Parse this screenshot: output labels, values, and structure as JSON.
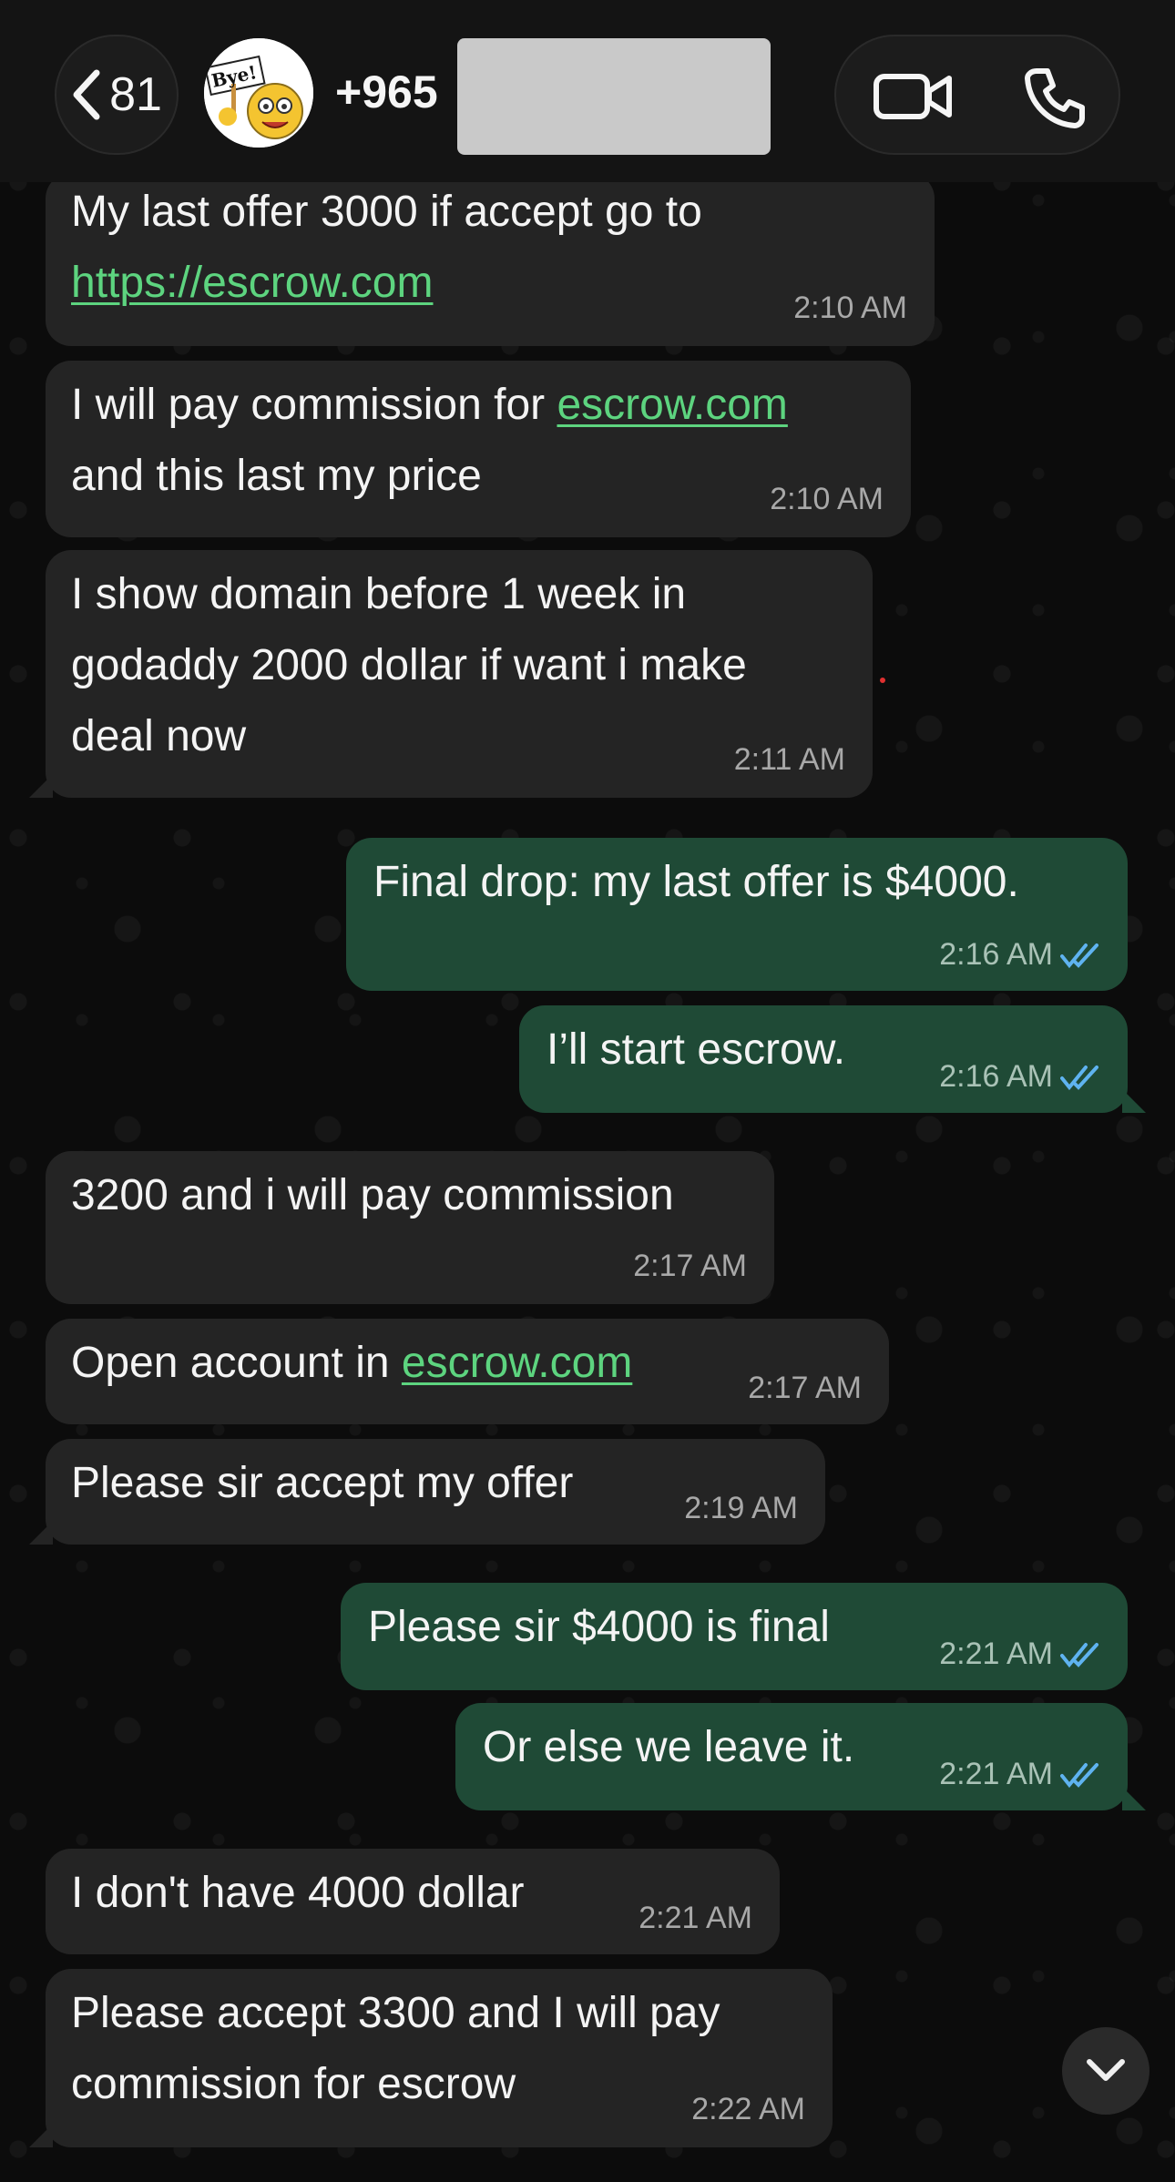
{
  "header": {
    "back_count": "81",
    "contact_label": "+965",
    "avatar_sign_text": "Bye!",
    "icons": [
      "chevron-left-icon",
      "video-call-icon",
      "phone-icon"
    ]
  },
  "colors": {
    "incoming_bubble": "#242424",
    "outgoing_bubble": "#1f4a36",
    "link": "#5dd47f",
    "read_ticks": "#5fb3f0"
  },
  "messages": [
    {
      "dir": "in",
      "lines": [
        "My last offer 3000 if accept go to",
        "https://escrow.com"
      ],
      "time": "2:10 AM"
    },
    {
      "dir": "in",
      "lines": [
        "I will pay commission for escrow.com",
        "and this last my price"
      ],
      "time": "2:10 AM"
    },
    {
      "dir": "in",
      "lines": [
        "I show domain before 1 week in",
        "godaddy 2000 dollar if want i make",
        "deal now"
      ],
      "time": "2:11 AM"
    },
    {
      "dir": "out",
      "lines": [
        "Final drop: my last offer is $4000."
      ],
      "time": "2:16 AM"
    },
    {
      "dir": "out",
      "lines": [
        "I’ll start escrow."
      ],
      "time": "2:16 AM"
    },
    {
      "dir": "in",
      "lines": [
        "3200 and i will pay commission"
      ],
      "time": "2:17 AM"
    },
    {
      "dir": "in",
      "lines": [
        "Open account in escrow.com"
      ],
      "time": "2:17 AM"
    },
    {
      "dir": "in",
      "lines": [
        "Please sir accept my offer"
      ],
      "time": "2:19 AM"
    },
    {
      "dir": "out",
      "lines": [
        "Please sir $4000 is final"
      ],
      "time": "2:21 AM"
    },
    {
      "dir": "out",
      "lines": [
        "Or else we leave it."
      ],
      "time": "2:21 AM"
    },
    {
      "dir": "in",
      "lines": [
        "I don't have 4000 dollar"
      ],
      "time": "2:21 AM"
    },
    {
      "dir": "in",
      "lines": [
        "Please accept 3300 and I will pay",
        "commission for escrow"
      ],
      "time": "2:22 AM"
    }
  ],
  "link_fragments": {
    "m0": "https://escrow.com",
    "m1_prefix": "I will pay commission for ",
    "m1_link": "escrow.com",
    "m6_prefix": "Open account in ",
    "m6_link": "escrow.com"
  }
}
